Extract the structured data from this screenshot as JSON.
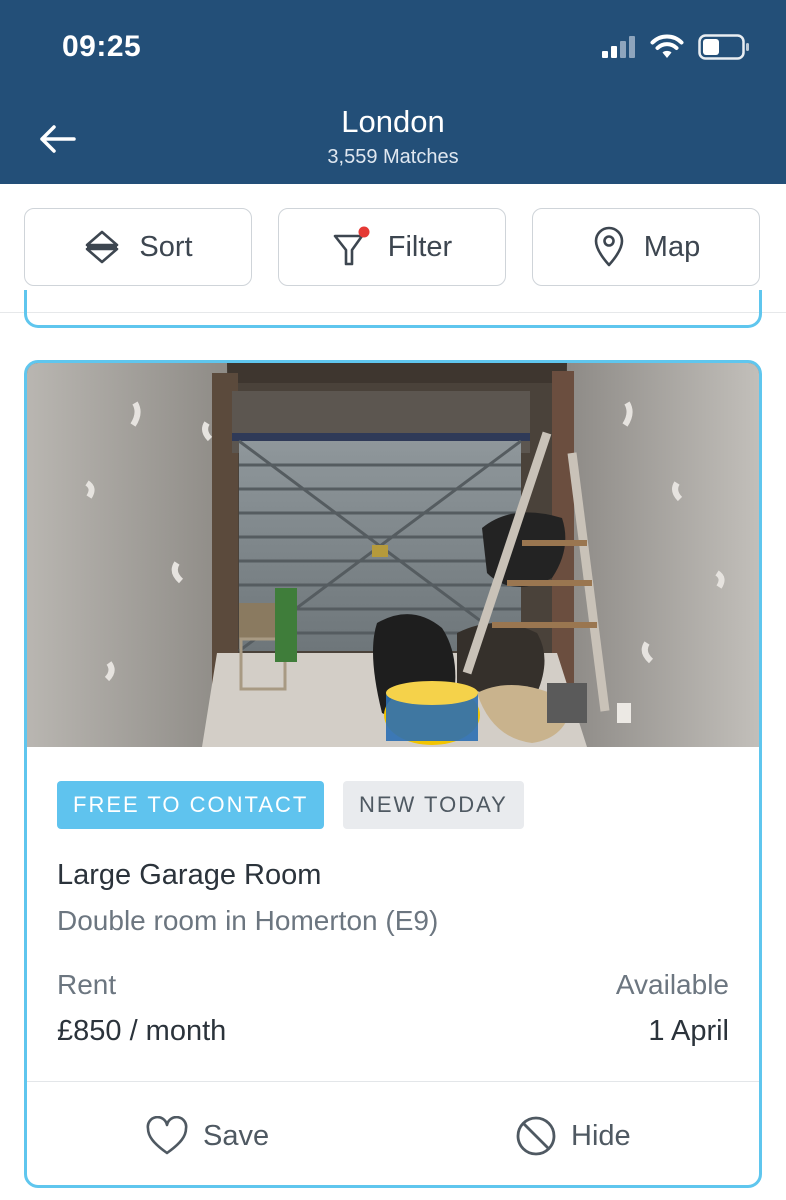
{
  "status": {
    "time": "09:25"
  },
  "header": {
    "title": "London",
    "subtitle": "3,559 Matches"
  },
  "toolbar": {
    "sort": "Sort",
    "filter": "Filter",
    "map": "Map"
  },
  "listing": {
    "badges": {
      "contact": "FREE TO CONTACT",
      "new": "NEW TODAY"
    },
    "title": "Large Garage Room",
    "subtitle": "Double room in Homerton (E9)",
    "rent_label": "Rent",
    "rent_value": "£850 / month",
    "available_label": "Available",
    "available_value": "1 April",
    "actions": {
      "save": "Save",
      "hide": "Hide"
    }
  },
  "colors": {
    "header_bg": "#234f78",
    "accent": "#5fc6ee",
    "badge_free": "#5fc3ee",
    "filter_dot": "#e53935"
  }
}
